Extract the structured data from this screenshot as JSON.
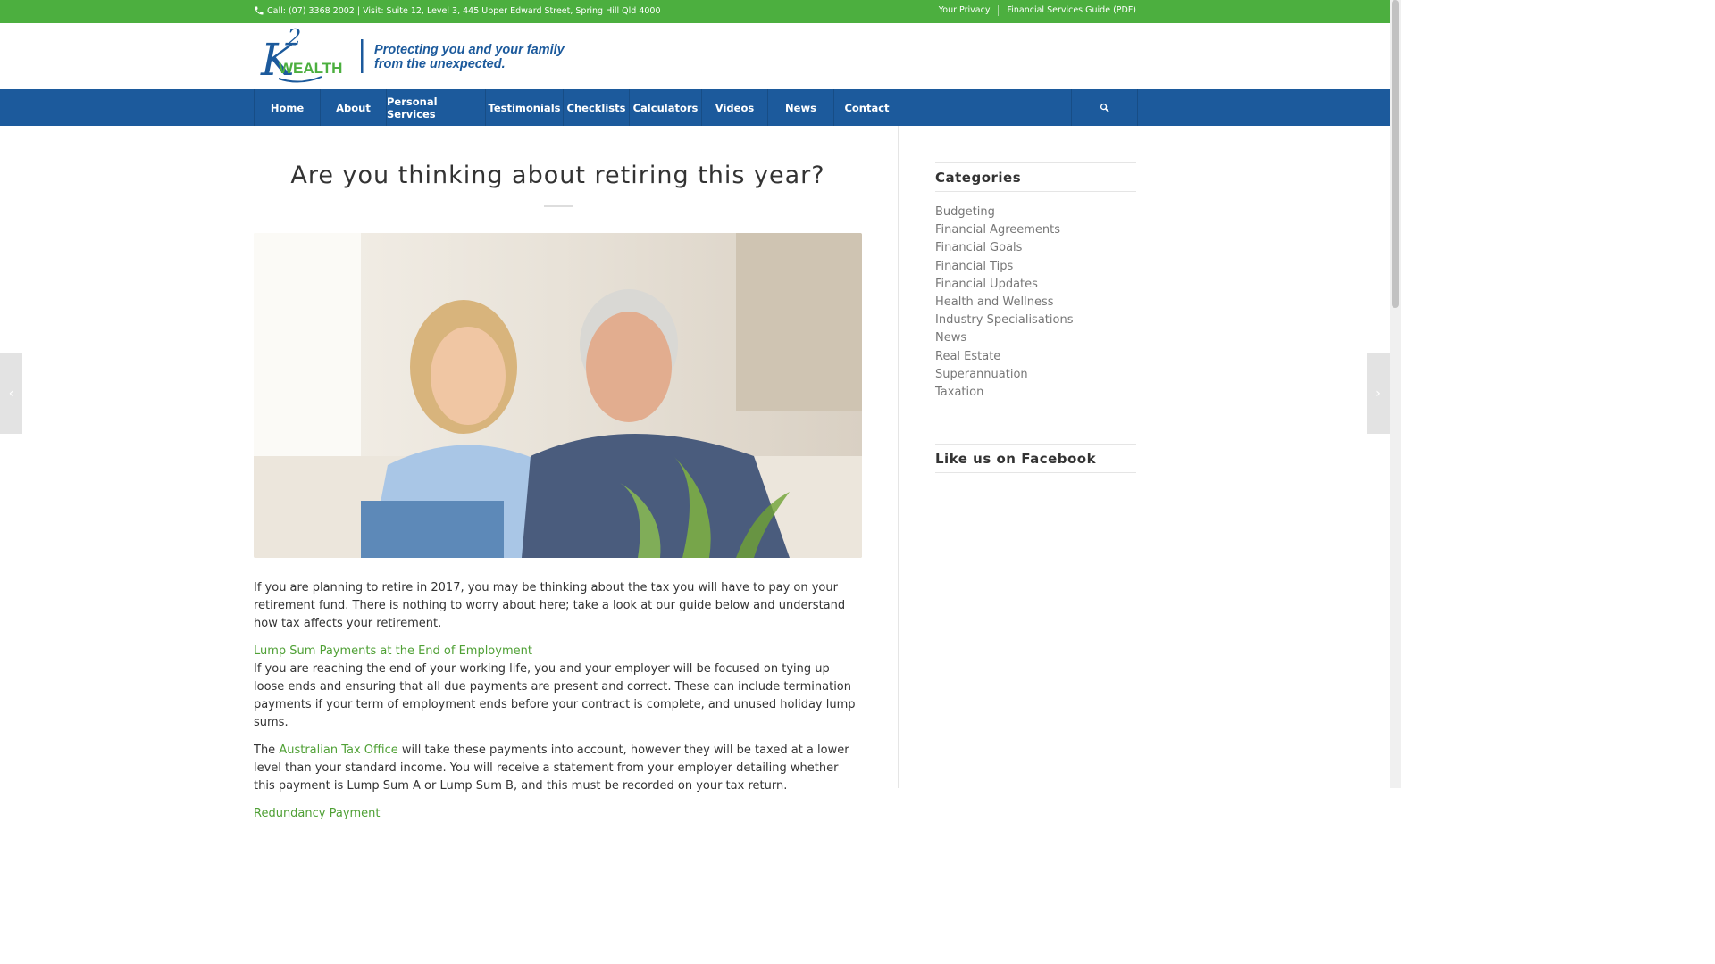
{
  "topbar": {
    "contact": "Call: (07) 3368 2002 | Visit: Suite 12, Level 3, 445 Upper Edward Street, Spring Hill Qld 4000",
    "privacy": "Your Privacy",
    "fsg": "Financial Services Guide (PDF)",
    "phone_icon": "phone-icon"
  },
  "logo": {
    "brand": "K2 WEALTH",
    "tagline_line1": "Protecting you and your family",
    "tagline_line2": "from the unexpected."
  },
  "nav": {
    "items": [
      "Home",
      "About",
      "Personal Services",
      "Testimonials",
      "Checklists",
      "Calculators",
      "Videos",
      "News",
      "Contact"
    ],
    "search_icon": "search-icon"
  },
  "article": {
    "title": "Are you thinking about retiring this year?",
    "image_alt": "Smiling couple sitting together on a couch",
    "p1": "If you are planning to retire in 2017, you may be thinking about the tax you will have to pay on your retirement fund. There is nothing to worry about here; take a look at our guide below and understand how tax affects your retirement.",
    "h1": "Lump Sum Payments at the End of Employment",
    "p2": "If you are reaching the end of your working life, you and your employer will be focused on tying up loose ends and ensuring that all due payments are present and correct. These can include termination payments if your term of employment ends before your contract is complete, and unused holiday lump sums.",
    "p3_pre": "The ",
    "p3_link": "Australian Tax Office",
    "p3_post": " will take these payments into account, however they will be taxed at a lower level than your standard income. You will receive a statement from your employer detailing whether this payment is Lump Sum A or Lump Sum B, and this must be recorded on your tax return.",
    "h2": "Redundancy Payment"
  },
  "sidebar": {
    "categories_title": "Categories",
    "categories": [
      "Budgeting",
      "Financial Agreements",
      "Financial Goals",
      "Financial Tips",
      "Financial Updates",
      "Health and Wellness",
      "Industry Specialisations",
      "News",
      "Real Estate",
      "Superannuation",
      "Taxation"
    ],
    "facebook_title": "Like us on Facebook"
  },
  "side_nav": {
    "prev_icon": "chevron-left-icon",
    "next_icon": "chevron-right-icon",
    "prev_glyph": "‹",
    "next_glyph": "›"
  },
  "colors": {
    "accent_green": "#4caf3f",
    "nav_blue": "#1c5a9c",
    "link_green": "#4fa035"
  }
}
